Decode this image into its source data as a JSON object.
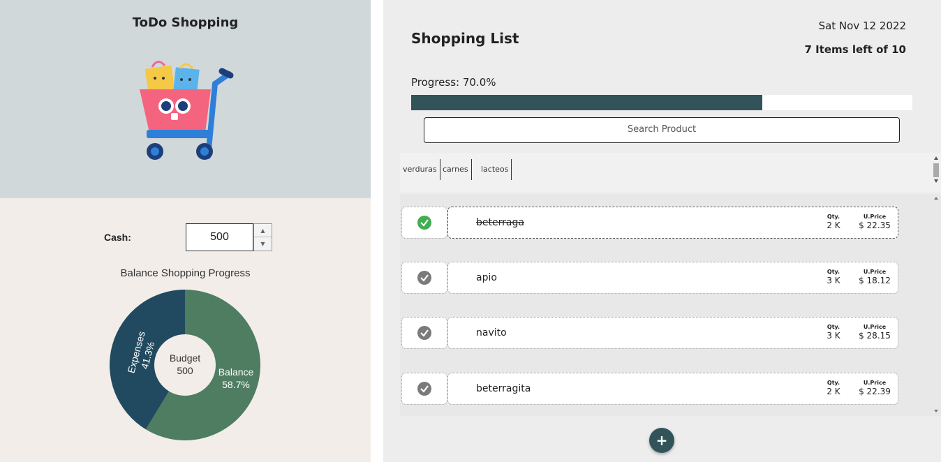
{
  "app": {
    "title": "ToDo Shopping"
  },
  "cash": {
    "label": "Cash:",
    "value": "500"
  },
  "balance_chart": {
    "title": "Balance Shopping Progress",
    "center_label": "Budget",
    "center_value": "500",
    "expenses_label": "Expenses",
    "expenses_pct": "41.3%",
    "balance_label": "Balance",
    "balance_pct": "58.7%",
    "colors": {
      "expenses": "#214a60",
      "balance": "#4e7d62"
    }
  },
  "header": {
    "title": "Shopping List",
    "date": "Sat Nov 12 2022",
    "items_left": "7 Items left of 10"
  },
  "progress": {
    "label": "Progress: 70.0%",
    "fraction": 0.7,
    "color": "#33535a"
  },
  "search": {
    "placeholder": "Search Product"
  },
  "tabs": [
    "verduras",
    "carnes",
    "lacteos"
  ],
  "items": [
    {
      "name": "beterraga",
      "qty_label": "Qty.",
      "qty": "2 K",
      "price_label": "U.Price",
      "price": "$ 22.35",
      "checked": true
    },
    {
      "name": "apio",
      "qty_label": "Qty.",
      "qty": "3 K",
      "price_label": "U.Price",
      "price": "$ 18.12",
      "checked": false
    },
    {
      "name": "navito",
      "qty_label": "Qty.",
      "qty": "3 K",
      "price_label": "U.Price",
      "price": "$ 28.15",
      "checked": false
    },
    {
      "name": "beterragita",
      "qty_label": "Qty.",
      "qty": "2 K",
      "price_label": "U.Price",
      "price": "$ 22.39",
      "checked": false
    }
  ],
  "add_button": {
    "label": "+"
  }
}
